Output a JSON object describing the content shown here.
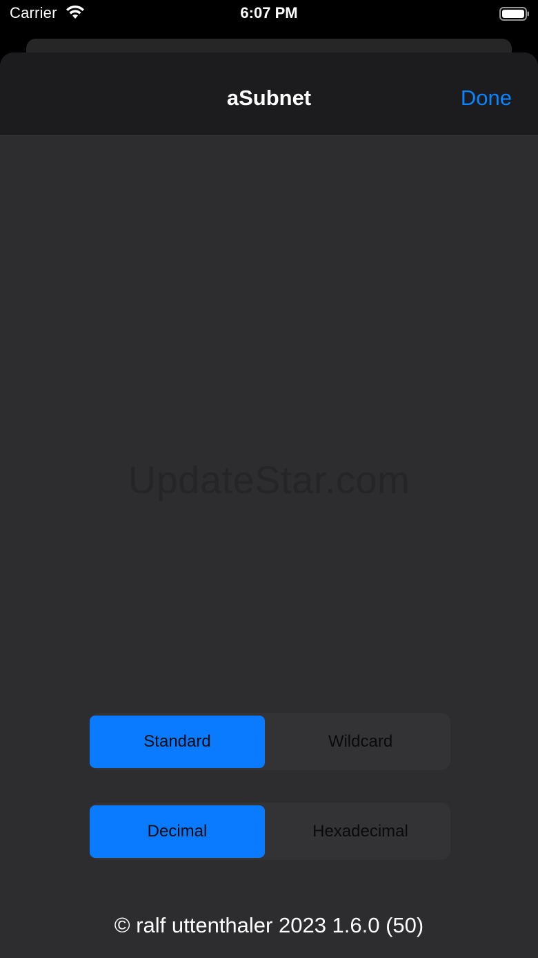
{
  "status_bar": {
    "carrier": "Carrier",
    "time": "6:07 PM",
    "icons": [
      "wifi-icon",
      "battery-icon"
    ]
  },
  "nav": {
    "title": "aSubnet",
    "done_label": "Done"
  },
  "watermark": "UpdateStar.com",
  "notation_control": {
    "options": [
      "Standard",
      "Wildcard"
    ],
    "selected": "Standard"
  },
  "format_control": {
    "options": [
      "Decimal",
      "Hexadecimal"
    ],
    "selected": "Decimal"
  },
  "footer": {
    "text": "© ralf uttenthaler 2023 1.6.0 (50)"
  },
  "colors": {
    "accent": "#0a84ff",
    "selected_segment": "#0a7aff",
    "background": "#2d2d2f",
    "nav_background": "#1c1c1e"
  }
}
